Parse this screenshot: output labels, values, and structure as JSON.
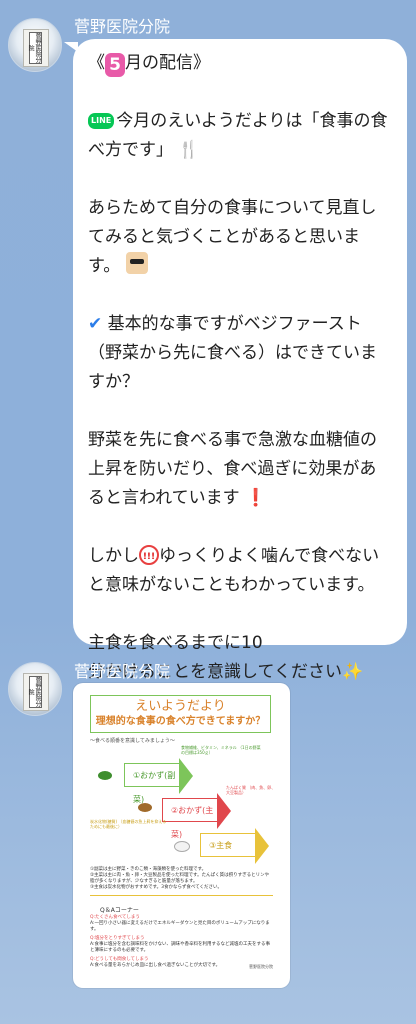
{
  "messages": [
    {
      "sender": "菅野医院分院",
      "avatar_sign": "菅野医院分院",
      "type": "text",
      "lines": {
        "l1_pre": "《",
        "l1_badge": "5",
        "l1_post": "月の配信》",
        "l2_badge": "LINE",
        "l2_text": "今月のえいようだよりは「食事の食",
        "l3_text": "べ方です」",
        "l3_icon": "🍴",
        "l4": "あらためて自分の食事について見直し",
        "l5": "てみると気づくことがあると思いま",
        "l6": "す。",
        "l7_icon": "✔",
        "l7_text": "基本的な事ですがベジファースト",
        "l8": "（野菜から先に食べる）はできていま",
        "l9": "すか？",
        "l10": "野菜を先に食べる事で急激な血糖値の",
        "l11": "上昇を防いだり、食べ過ぎに効果があ",
        "l12_text": "ると言われています",
        "l12_icon": "❗",
        "l13_pre": "しかし",
        "l13_icon": "!!!",
        "l13_post": "ゆっくりよく噛んで食べない",
        "l14": "と意味がないこともわかっています。",
        "l15": "主食を食べるまでに10",
        "l16_text": "分かけることを意識してください",
        "l16_icon": "✨"
      }
    },
    {
      "sender": "菅野医院分院",
      "avatar_sign": "菅野医院分院",
      "type": "image",
      "flyer": {
        "title": "えいようだより",
        "subtitle": "理想的な食事の食べ方できてますか？",
        "intro": "～食べる順番を意識してみましょう～",
        "step1": "①おかず(副菜)",
        "step2": "②おかず(主菜)",
        "step3": "③主食",
        "note1": "食物繊維、ビタミン、ミネラル\n（1日の野菜の目標は350ｇ）",
        "note2": "たんぱく質\n（肉、魚、卵、大豆製品）",
        "note3": "炭水化物(糖質)\n（血糖値の急上昇を抑えるためにも最後に）",
        "desc": "①副菜は主に野菜・きのこ類・海藻類を使った料理です。\n②主菜は主に肉・魚・卵・大豆製品を使った料理です。たんぱく質は摂りすぎるとリンや脂が多くなりますが、少なすぎると筋量が落ちます。\n③主食は炭水化物がおすすめです。3食かならず食べてください。",
        "qa_title": "Q＆Aコーナー",
        "q1": "Q:たくさん食べてしまう",
        "a1": "A:一回り小さい器に変えるだけでエネルギーダウンと見た目のボリュームアップになります。",
        "q2": "Q:塩分をとりすぎてしまう",
        "a2": "A:食事に塩分を含む調味料をかけない、調味や香辛料を利用するなど減塩の工夫をする事と薄味にするのも必要です。",
        "q3": "Q:どうしても間食してしまう",
        "a3": "A:食べる量をあらかじめ皿に出し食べ過ぎないことが大切です。",
        "credit": "菅野医院分院"
      }
    }
  ],
  "colors": {
    "background": "#8fb0d9",
    "bubble": "#ffffff",
    "line_green": "#06c755",
    "badge_pink": "#e85aa8",
    "check_blue": "#2b7de9",
    "exclaim_red": "#e02020"
  }
}
